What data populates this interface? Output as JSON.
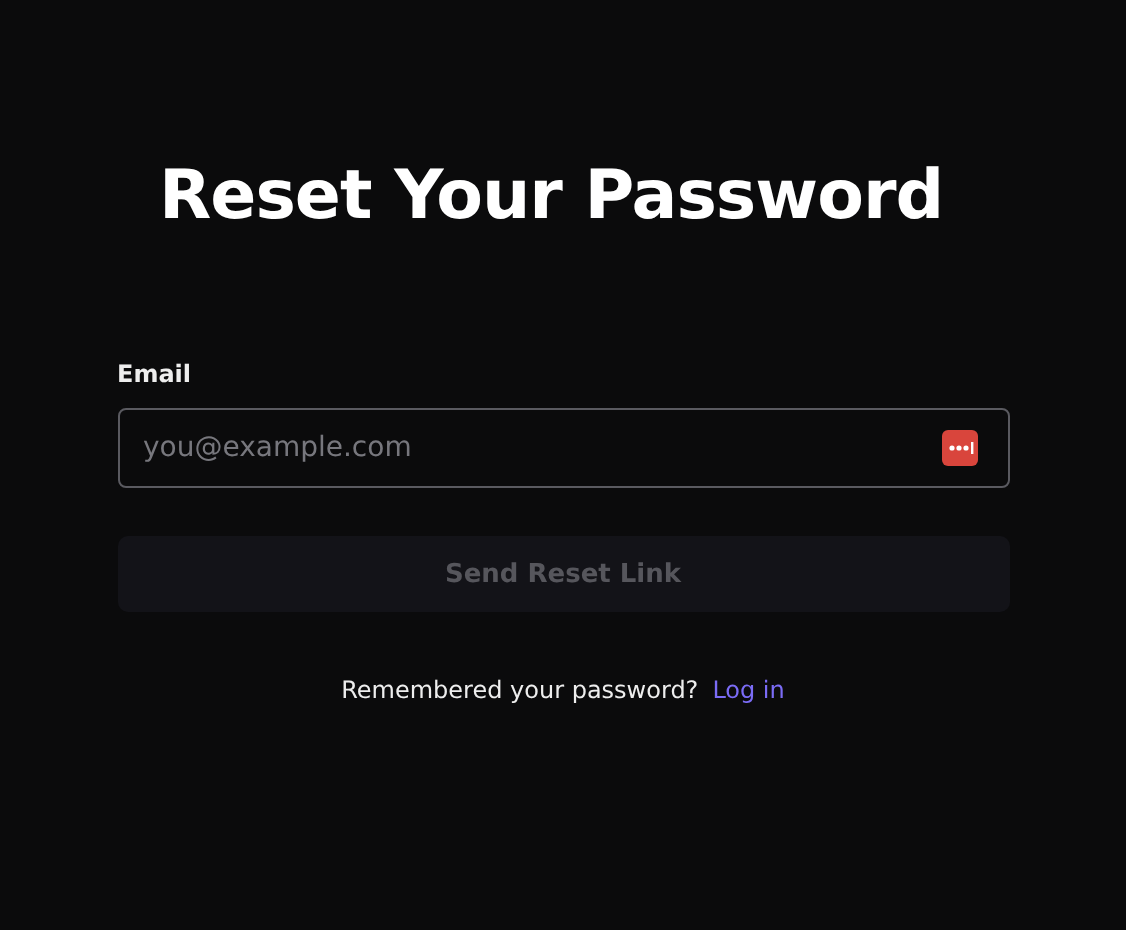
{
  "title": "Reset Your Password",
  "email_field": {
    "label": "Email",
    "placeholder": "you@example.com"
  },
  "submit_button": {
    "label": "Send Reset Link",
    "disabled": true
  },
  "footer": {
    "text": "Remembered your password?",
    "link": "Log in"
  }
}
